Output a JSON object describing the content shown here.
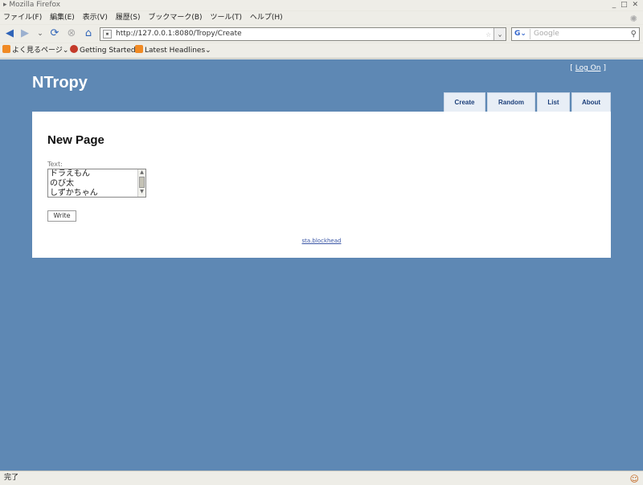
{
  "window": {
    "title": "Mozilla Firefox",
    "controls": [
      "_",
      "□",
      "✕"
    ]
  },
  "menubar": {
    "items": [
      "ファイル(F)",
      "編集(E)",
      "表示(V)",
      "履歴(S)",
      "ブックマーク(B)",
      "ツール(T)",
      "ヘルプ(H)"
    ]
  },
  "navbar": {
    "url": "http://127.0.0.1:8080/Tropy/Create",
    "search_placeholder": "Google",
    "search_engine": "G",
    "icons": [
      "back-arrow-icon",
      "forward-arrow-icon",
      "history-dropdown-icon",
      "reload-icon",
      "stop-icon",
      "home-icon"
    ]
  },
  "bookmarks": {
    "items": [
      "よく見るページ",
      "Getting Started",
      "Latest Headlines"
    ]
  },
  "page": {
    "logon_open": "[",
    "logon_link": "Log On",
    "logon_close": "]",
    "site_title": "NTropy",
    "tabs": [
      "Create",
      "Random",
      "List",
      "About"
    ],
    "heading": "New Page",
    "text_label": "Text:",
    "textarea_lines": [
      "ドラえもん",
      "のび太",
      "しずかちゃん"
    ],
    "write_button": "Write",
    "footer_link": "sta.blockhead"
  },
  "statusbar": {
    "text": "完了"
  },
  "colors": {
    "page_background": "#5e88b4",
    "tab_text": "#1c3f7a",
    "tab_background": "#e8eef6",
    "link": "#3955a5"
  }
}
